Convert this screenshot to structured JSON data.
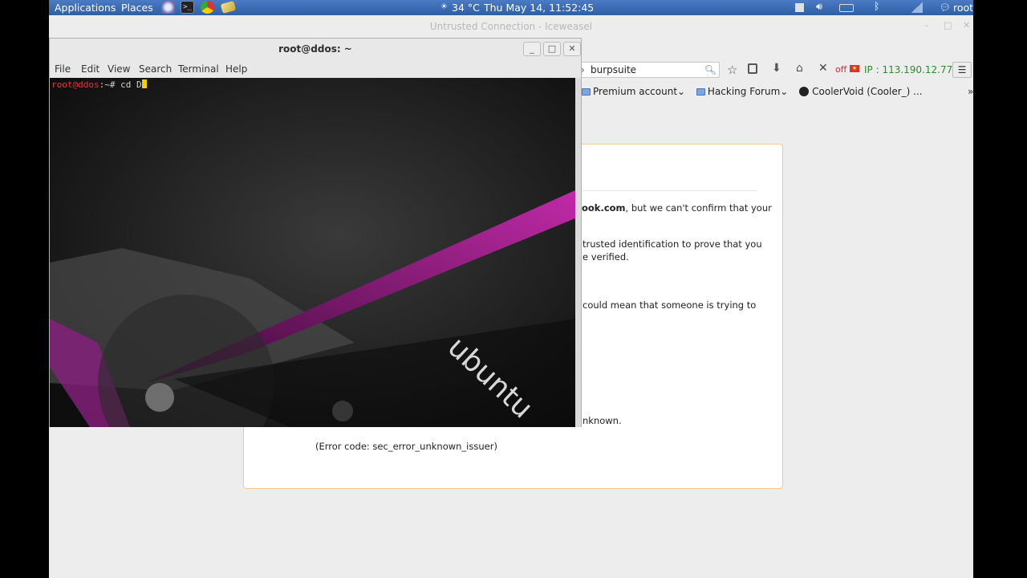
{
  "panel": {
    "applications": "Applications",
    "places": "Places",
    "weather": "34 °C",
    "datetime": "Thu May 14, 11:52:45",
    "user": "root"
  },
  "browser": {
    "title": "Untrusted Connection - Iceweasel",
    "search_value": "burpsuite",
    "proxy_status": "off",
    "ip_text": "IP : 113.190.12.77",
    "bookmarks": [
      "Premium account",
      "Hacking Forum",
      "CoolerVoid (Cooler_) ..."
    ],
    "more_bookmarks": "»"
  },
  "error_page": {
    "line1_bold": "ook.com",
    "line1_rest": ", but we can't confirm that your",
    "line2": "trusted identification to prove that you",
    "line3": "e verified.",
    "line4": "could mean that someone is trying to",
    "line5": "nknown.",
    "error_code": "(Error code: sec_error_unknown_issuer)"
  },
  "terminal": {
    "title": "root@ddos: ~",
    "menu": [
      "File",
      "Edit",
      "View",
      "Search",
      "Terminal",
      "Help"
    ],
    "prompt_user": "root@ddos",
    "prompt_rest": ":~# ",
    "command": "cd D",
    "wallpaper_text": "ubuntu"
  },
  "colors": {
    "panel": "#3465a4",
    "prompt": "#e8323c",
    "cursor": "#f0d000",
    "ip_green": "#2e8b2e",
    "proxy_off": "#d03030",
    "error_border": "#f2c98a",
    "magenta": "#b0249f"
  }
}
